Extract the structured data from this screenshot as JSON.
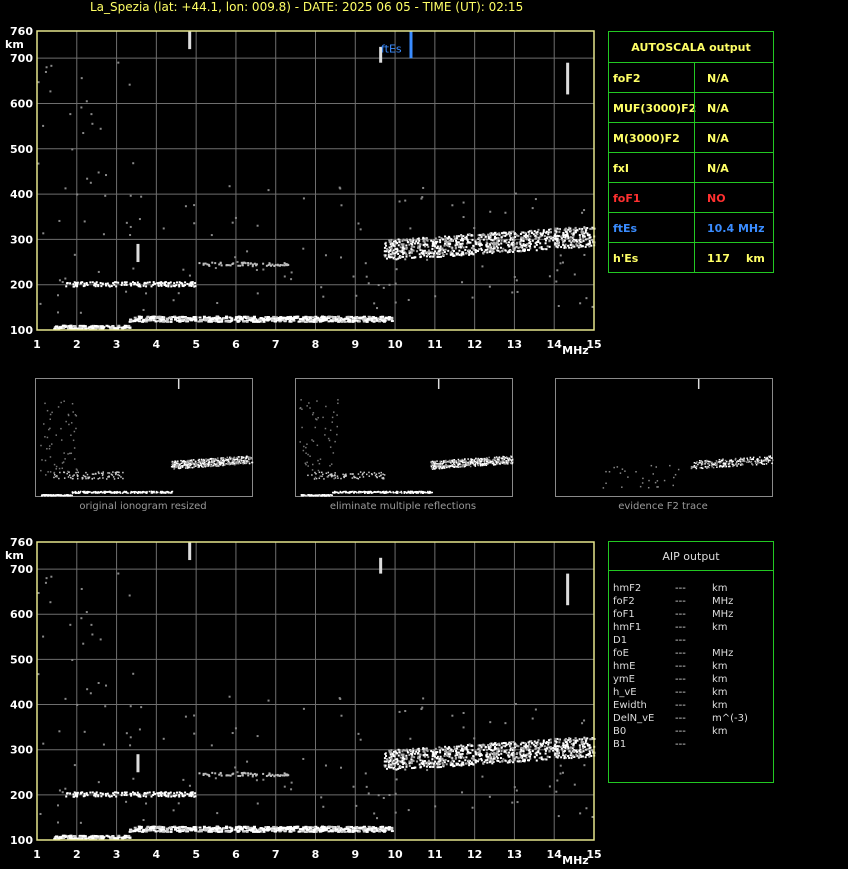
{
  "title": "La_Spezia (lat: +44.1, lon: 009.8) - DATE: 2025 06 05 - TIME (UT): 02:15",
  "colors": {
    "axis": "#e6e68c",
    "grid": "#6e6e6e",
    "table_border": "#22c822",
    "label": "#ffff66",
    "red": "#ff3030",
    "blue": "#3a8cff"
  },
  "chart_data": [
    {
      "type": "scatter",
      "name": "ionogram-main",
      "xlim": [
        1,
        15
      ],
      "ylim": [
        100,
        760
      ],
      "xticks": [
        "1",
        "2",
        "3",
        "4",
        "5",
        "6",
        "7",
        "8",
        "9",
        "10",
        "11",
        "12",
        "13",
        "14",
        "15"
      ],
      "yticks": [
        "100",
        "200",
        "300",
        "400",
        "500",
        "600",
        "700",
        "760"
      ],
      "xunit": "MHz",
      "yunit": "km",
      "annotations": [
        {
          "label": "ftEs",
          "x": 10.4
        }
      ],
      "traces": [
        {
          "id": "E-layer",
          "x_range": [
            1.4,
            9.9
          ],
          "h_range": [
            100,
            130
          ]
        },
        {
          "id": "Es-layer",
          "x_range": [
            1.7,
            5.2
          ],
          "h_range": [
            195,
            210
          ]
        },
        {
          "id": "F-layer",
          "x_range": [
            9.7,
            15
          ],
          "h_range": [
            250,
            320
          ]
        }
      ]
    },
    {
      "type": "scatter",
      "name": "ionogram-aip",
      "xlim": [
        1,
        15
      ],
      "ylim": [
        100,
        760
      ],
      "xticks": [
        "1",
        "2",
        "3",
        "4",
        "5",
        "6",
        "7",
        "8",
        "9",
        "10",
        "11",
        "12",
        "13",
        "14",
        "15"
      ],
      "yticks": [
        "100",
        "200",
        "300",
        "400",
        "500",
        "600",
        "700",
        "760"
      ],
      "xunit": "MHz",
      "yunit": "km"
    }
  ],
  "autoscala": {
    "title": "AUTOSCALA output",
    "rows": [
      {
        "param": "foF2",
        "value": "N/A",
        "color": "yellow"
      },
      {
        "param": "MUF(3000)F2",
        "value": "N/A",
        "color": "yellow"
      },
      {
        "param": "M(3000)F2",
        "value": "N/A",
        "color": "yellow"
      },
      {
        "param": "fxI",
        "value": "N/A",
        "color": "yellow"
      },
      {
        "param": "foF1",
        "value": "NO",
        "color": "red"
      },
      {
        "param": "ftEs",
        "value": "10.4 MHz",
        "color": "blue"
      },
      {
        "param": "h'Es",
        "value": "117",
        "unit": "km",
        "color": "yellow"
      }
    ]
  },
  "thumbnails": [
    {
      "caption": "original ionogram resized"
    },
    {
      "caption": "eliminate multiple reflections"
    },
    {
      "caption": "evidence F2 trace"
    }
  ],
  "aip": {
    "title": "AIP output",
    "rows": [
      {
        "param": "hmF2",
        "value": "---",
        "unit": "km"
      },
      {
        "param": "foF2",
        "value": "---",
        "unit": "MHz"
      },
      {
        "param": "foF1",
        "value": "---",
        "unit": "MHz"
      },
      {
        "param": "hmF1",
        "value": "---",
        "unit": "km"
      },
      {
        "param": "D1",
        "value": "---",
        "unit": ""
      },
      {
        "param": "foE",
        "value": "---",
        "unit": "MHz"
      },
      {
        "param": "hmE",
        "value": "---",
        "unit": "km"
      },
      {
        "param": "ymE",
        "value": "---",
        "unit": "km"
      },
      {
        "param": "h_vE",
        "value": "---",
        "unit": "km"
      },
      {
        "param": "Ewidth",
        "value": "---",
        "unit": "km"
      },
      {
        "param": "DelN_vE",
        "value": "---",
        "unit": "m^(-3)"
      },
      {
        "param": "B0",
        "value": "---",
        "unit": "km"
      },
      {
        "param": "B1",
        "value": "---",
        "unit": ""
      }
    ]
  }
}
